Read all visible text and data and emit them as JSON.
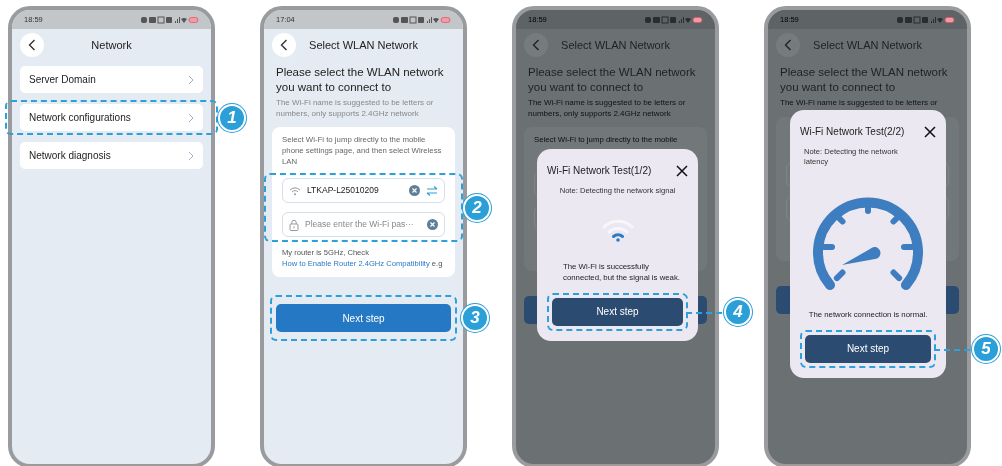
{
  "screens": [
    {
      "kind": "menu",
      "time": "18:59",
      "title": "Network",
      "items": [
        {
          "label": "Server Domain",
          "highlighted": false
        },
        {
          "label": "Network configurations",
          "highlighted": true,
          "callout": "1"
        },
        {
          "label": "Network diagnosis",
          "highlighted": false
        }
      ]
    },
    {
      "kind": "form",
      "time": "17:04",
      "title": "Select WLAN Network",
      "heading": "Please select the WLAN network you want to connect to",
      "hint": "The Wi-Fi name is suggested to be letters or numbers, only supports 2.4GHz network",
      "card_text": "Select Wi-Fi to jump directly to the mobile phone settings page, and then select Wireless LAN",
      "wifi_value": "LTKAP-L25010209",
      "password_placeholder": "Please enter the Wi-Fi pas···",
      "fields_callout": "2",
      "note_text": "My router is 5GHz, Check ",
      "note_link": "How to Enable Router 2.4GHz Compatibility",
      "note_suffix": " e.g",
      "button": "Next step",
      "button_callout": "3"
    },
    {
      "kind": "dialog",
      "time": "18:59",
      "title": "Select WLAN Network",
      "heading": "Please select the WLAN network you want to connect to",
      "hint": "The Wi-Fi name is suggested to be letters or numbers, only supports 2.4GHz network",
      "card_text": "Select Wi-Fi to jump directly to the mobile",
      "dialog": {
        "title": "Wi-Fi Network Test(1/2)",
        "note": "Note: Detecting the network signal",
        "kind": "signal",
        "message": "The Wi-Fi is successfully connected, but the signal is weak.",
        "button": "Next step",
        "callout": "4"
      }
    },
    {
      "kind": "dialog",
      "time": "18:59",
      "title": "Select WLAN Network",
      "heading": "Please select the WLAN network you want to connect to",
      "hint": "The Wi-Fi name is suggested to be letters or",
      "dialog": {
        "title": "Wi-Fi Network Test(2/2)",
        "note": "Note: Detecting the network latency",
        "kind": "latency",
        "message": "The network connection is normal.",
        "button": "Next step",
        "callout": "5"
      }
    }
  ]
}
